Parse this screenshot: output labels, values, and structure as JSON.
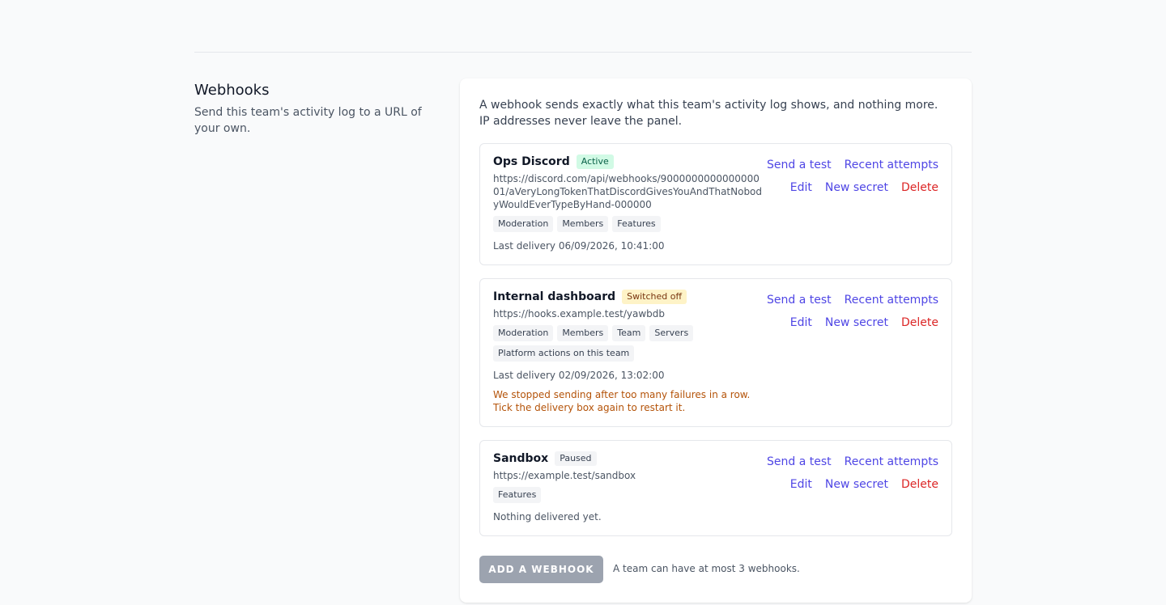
{
  "section": {
    "title": "Webhooks",
    "description": "Send this team's activity log to a URL of your own."
  },
  "panel": {
    "intro": "A webhook sends exactly what this team's activity log shows, and nothing more. IP addresses never leave the panel."
  },
  "actions": {
    "send_test": "Send a test",
    "recent_attempts": "Recent attempts",
    "edit": "Edit",
    "new_secret": "New secret",
    "delete": "Delete"
  },
  "webhooks": [
    {
      "name": "Ops Discord",
      "status": "Active",
      "url": "https://discord.com/api/webhooks/900000000000000001/aVeryLongTokenThatDiscordGivesYouAndThatNobodyWouldEverTypeByHand-000000",
      "tags": [
        "Moderation",
        "Members",
        "Features"
      ],
      "last_delivery": "Last delivery 06/09/2026, 10:41:00"
    },
    {
      "name": "Internal dashboard",
      "status": "Switched off",
      "url": "https://hooks.example.test/yawbdb",
      "tags": [
        "Moderation",
        "Members",
        "Team",
        "Servers",
        "Platform actions on this team"
      ],
      "last_delivery": "Last delivery 02/09/2026, 13:02:00",
      "warning": "We stopped sending after too many failures in a row. Tick the delivery box again to restart it."
    },
    {
      "name": "Sandbox",
      "status": "Paused",
      "url": "https://example.test/sandbox",
      "tags": [
        "Features"
      ],
      "last_delivery": "Nothing delivered yet."
    }
  ],
  "footer": {
    "add_button": "ADD A WEBHOOK",
    "limit_note": "A team can have at most 3 webhooks."
  },
  "colors": {
    "link": "#4f46e5",
    "danger": "#dc2626",
    "active_badge": "#d1fae5",
    "off_badge": "#fef3c7",
    "warning_text": "#b45309",
    "disabled_button": "#9ca3af"
  }
}
